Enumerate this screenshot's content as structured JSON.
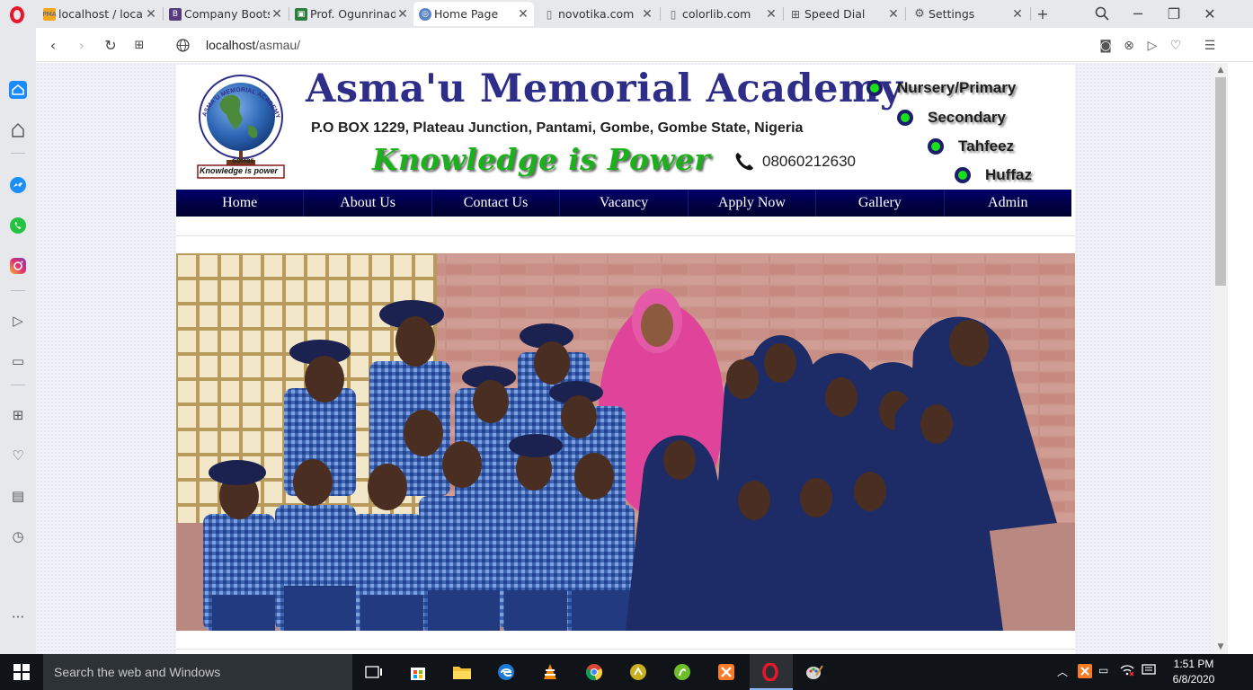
{
  "browser": {
    "tabs": [
      {
        "title": "localhost / localhost",
        "favicon": "phpmyadmin-icon"
      },
      {
        "title": "Company Bootstrap",
        "favicon": "bootstrap-icon"
      },
      {
        "title": "Prof. Ogunrinade",
        "favicon": "document-icon"
      },
      {
        "title": "Home Page",
        "favicon": "globe-icon",
        "active": true
      },
      {
        "title": "novotika.com",
        "favicon": "page-icon"
      },
      {
        "title": "colorlib.com",
        "favicon": "page-icon"
      },
      {
        "title": "Speed Dial",
        "favicon": "speed-dial-icon"
      },
      {
        "title": "Settings",
        "favicon": "gear-icon"
      }
    ],
    "address": {
      "host": "localhost",
      "path": "/asmau/"
    }
  },
  "site": {
    "name": "Asma'u Memorial Academy",
    "address": "P.O BOX 1229, Plateau Junction, Pantami, Gombe, Gombe State, Nigeria",
    "motto": "Knowledge is Power",
    "phone": "08060212630",
    "sections": [
      "Nursery/Primary",
      "Secondary",
      "Tahfeez",
      "Huffaz"
    ],
    "logo": {
      "ring_text": "ASMA'U MEMORIAL ACADEMY",
      "inner_text": "GOMBE",
      "banner_text": "Knowledge is power"
    },
    "nav": [
      "Home",
      "About Us",
      "Contact Us",
      "Vacancy",
      "Apply Now",
      "Gallery",
      "Admin"
    ]
  },
  "taskbar": {
    "search_placeholder": "Search the web and Windows",
    "time": "1:51 PM",
    "date": "6/8/2020"
  },
  "colors": {
    "brand_blue": "#2e2e88",
    "motto_green": "#1cb11c",
    "nav_bg": "#000050",
    "opera_red": "#e8172b"
  }
}
